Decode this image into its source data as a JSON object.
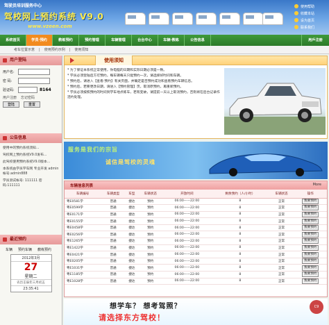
{
  "header": {
    "sub_title": "驾驶员培训服务中心",
    "main_title": "驾校网上预约系统 V9.0",
    "url": "www.vzeen.com",
    "quick_links": [
      "使用帮助",
      "收藏本站",
      "设为首页",
      "联系我们"
    ]
  },
  "nav": {
    "items": [
      "系统首页",
      "学员·预约",
      "教练预约",
      "预约管理",
      "车辆管理",
      "台台中心",
      "车辆·教练",
      "公告信息"
    ],
    "active_index": 1,
    "right": "用戶注册"
  },
  "breadcrumb": [
    "考车位置示意",
    "使用预约示例",
    "使用须知"
  ],
  "login": {
    "title": "用户登陆",
    "username_label": "用户名:",
    "password_label": "密 码:",
    "code_label": "验证码:",
    "captcha": "8164",
    "links": [
      "用户注册",
      "忘记密码"
    ],
    "login_button": "登陆",
    "reset_button": "重置"
  },
  "notices": {
    "title": "公告信息",
    "items": [
      "使用中的预约系统须知...",
      "驾校网上预约系统V9.0发布...",
      "此驾校使用预约系统V9.0版本...",
      "本系统由学员学车网 专业开发 admin帐号:admin888",
      "学员测试帐号: 111111 密码:111111"
    ]
  },
  "calendar": {
    "title": "最近预约",
    "tabs": [
      "车辆",
      "预约车辆",
      "教练预约"
    ],
    "year_month": "2012年3月",
    "day": "27",
    "weekday": "星期二",
    "lunar": "农历壬辰年三月初五",
    "time": "23:35:41"
  },
  "usage": {
    "title": "使用须知",
    "paragraphs": [
      "* 为了保证本系统正常使用，你电脑的日期和实际日期必须是一致。",
      "* 学员必须登陆后方可预约，每车辆每天只能预约一次，请选择好时间和车辆。",
      "* 预约后，请进入【查看·预约】有关页面，并确定是否预约成功和查看预约车辆信息。",
      "* 预约后，若要更改日期，请进入【预约管理】页，取消原预约，再重新预约。",
      "* 学员必须按照预约的时间到学车地点练车，若有变故，请提前一天以上取消预约，否则将在后台记录作违约处理。"
    ]
  },
  "banner": {
    "slogan1": "服务是我们的宗旨",
    "slogan2": "诚信是驾校的灵魂"
  },
  "vehicles": {
    "title": "车辆信息列表",
    "more": "More",
    "columns": [
      "车辆编号",
      "车辆类型",
      "车型",
      "车辆状态",
      "开放时间",
      "剩余预约（人/小时）",
      "车辆状态",
      "操作"
    ],
    "action_label": "我要预约",
    "rows": [
      [
        "粤E0581学",
        "普通",
        "捷达",
        "预约",
        "06:00——22:00",
        "8",
        "正常"
      ],
      [
        "粤E0599学",
        "普通",
        "捷达",
        "预约",
        "06:00——22:00",
        "8",
        "正常"
      ],
      [
        "粤E0171学",
        "普通",
        "捷达",
        "预约",
        "06:00——22:00",
        "8",
        "正常"
      ],
      [
        "粤E0155学",
        "普通",
        "捷达",
        "预约",
        "06:00——22:00",
        "8",
        "正常"
      ],
      [
        "粤E0458学",
        "普通",
        "捷达",
        "预约",
        "06:00——22:00",
        "8",
        "正常"
      ],
      [
        "粤E0256学",
        "普通",
        "捷达",
        "预约",
        "06:00——22:00",
        "8",
        "正常"
      ],
      [
        "粤E1265学",
        "普通",
        "捷达",
        "预约",
        "06:00——22:00",
        "8",
        "正常"
      ],
      [
        "粤E1422学",
        "普通",
        "捷达",
        "预约",
        "06:00——22:00",
        "8",
        "正常"
      ],
      [
        "粤E0421学",
        "普通",
        "捷达",
        "预约",
        "06:00——22:00",
        "8",
        "正常"
      ],
      [
        "粤E0205学",
        "普通",
        "捷达",
        "预约",
        "06:00——22:00",
        "8",
        "正常"
      ],
      [
        "粤E1031学",
        "普通",
        "捷达",
        "预约",
        "06:00——22:00",
        "8",
        "正常"
      ],
      [
        "粤E1185学",
        "普通",
        "捷达",
        "预约",
        "06:00——22:00",
        "8",
        "正常"
      ],
      [
        "粤E1028学",
        "普通",
        "捷达",
        "预约",
        "06:00——22:00",
        "8",
        "正常"
      ]
    ]
  },
  "ad": {
    "line1": "想学车？  想考驾照？",
    "line2": "请选择东方驾校！",
    "badge": "C9"
  },
  "colors": {
    "nav_green": "#2c7a29",
    "nav_active": "#f28b1e",
    "panel_red": "#8a1010",
    "title_yellow": "#ffec4d"
  }
}
